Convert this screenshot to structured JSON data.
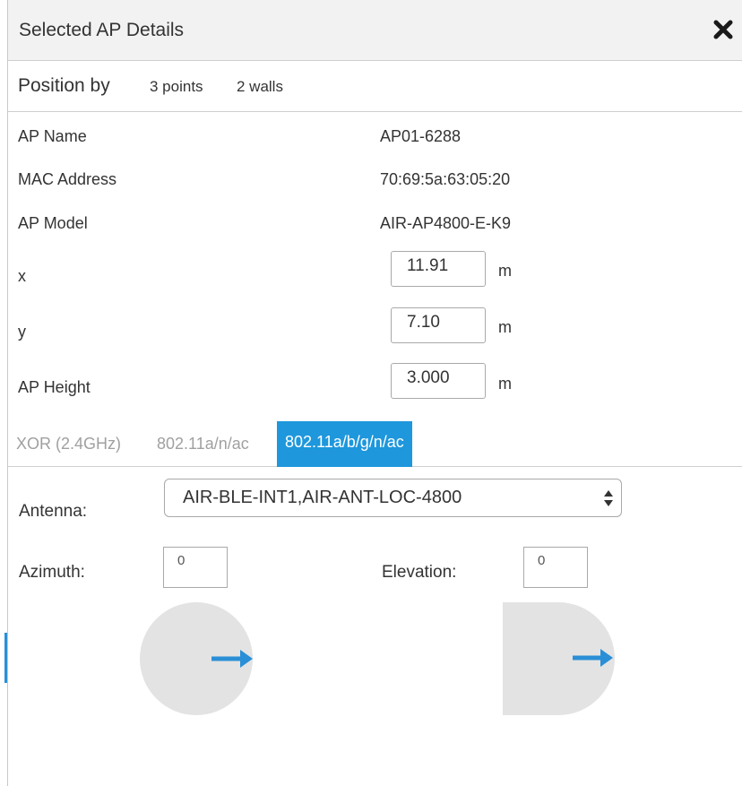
{
  "header": {
    "title": "Selected AP Details",
    "close_icon": "close-icon"
  },
  "position_by": {
    "label": "Position by",
    "options": [
      "3 points",
      "2 walls"
    ]
  },
  "details": [
    {
      "label": "AP Name",
      "value": "AP01-6288"
    },
    {
      "label": "MAC Address",
      "value": "70:69:5a:63:05:20"
    },
    {
      "label": "AP Model",
      "value": "AIR-AP4800-E-K9"
    }
  ],
  "coordinates": {
    "x": {
      "label": "x",
      "value": "11.91",
      "unit": "m"
    },
    "y": {
      "label": "y",
      "value": "7.10",
      "unit": "m"
    },
    "height": {
      "label": "AP Height",
      "value": "3.000",
      "unit": "m"
    }
  },
  "radio_tabs": {
    "items": [
      "XOR (2.4GHz)",
      "802.11a/n/ac",
      "802.11a/b/g/n/ac"
    ],
    "active": "802.11a/b/g/n/ac",
    "active_color": "#1e97dc"
  },
  "antenna": {
    "label": "Antenna:",
    "value": "AIR-BLE-INT1,AIR-ANT-LOC-4800"
  },
  "azimuth": {
    "label": "Azimuth:",
    "value": "0",
    "icon": "azimuth-dial-icon"
  },
  "elevation": {
    "label": "Elevation:",
    "value": "0",
    "icon": "elevation-dial-icon"
  },
  "colors": {
    "arrow": "#2a8fd6",
    "dial_fill": "#e3e3e3"
  }
}
